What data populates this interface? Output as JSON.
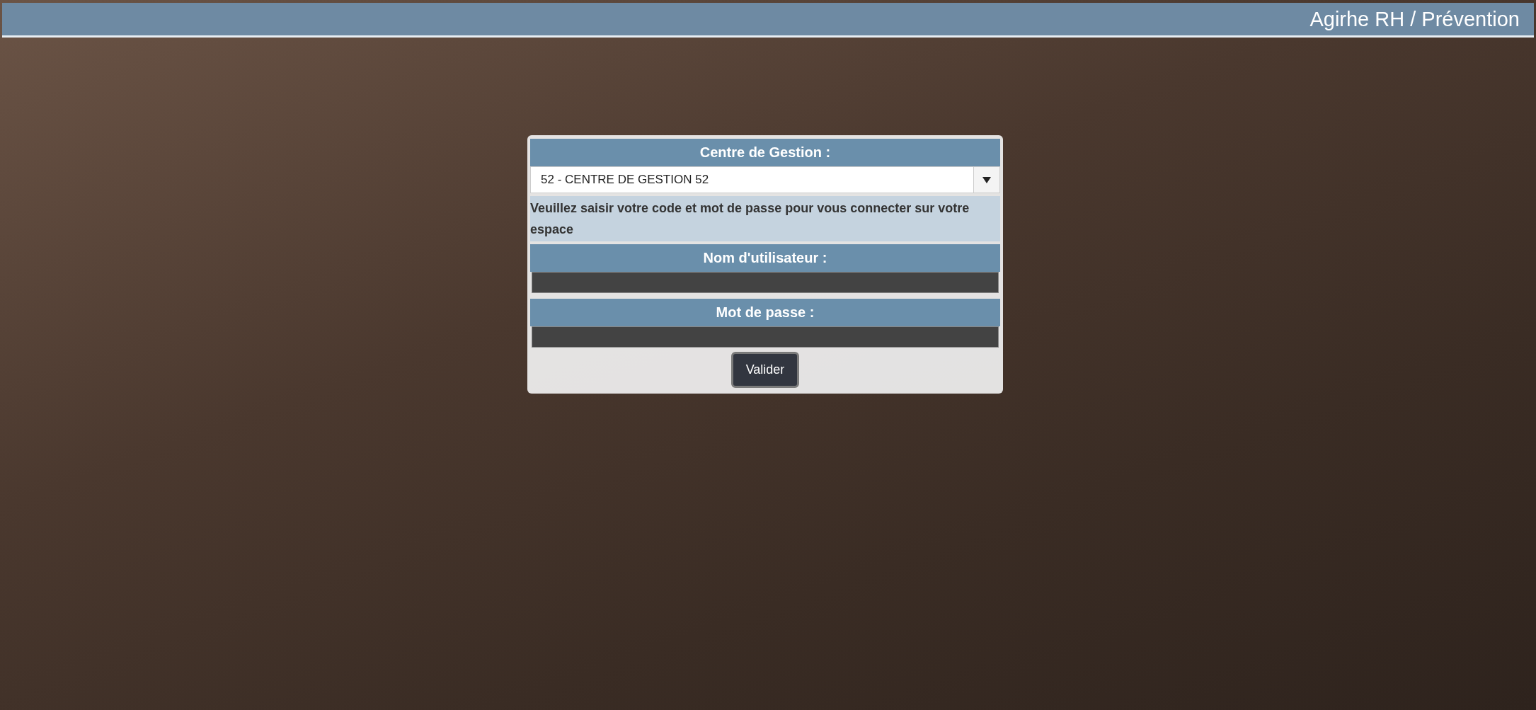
{
  "header": {
    "title": "Agirhe RH / Prévention"
  },
  "login": {
    "centre_label": "Centre de Gestion :",
    "centre_select": {
      "value": "52 - CENTRE DE GESTION 52"
    },
    "instruction": "Veuillez saisir votre code et mot de passe pour vous connecter sur votre espace",
    "username_label": "Nom d'utilisateur :",
    "password_label": "Mot de passe :",
    "submit": "Valider"
  }
}
